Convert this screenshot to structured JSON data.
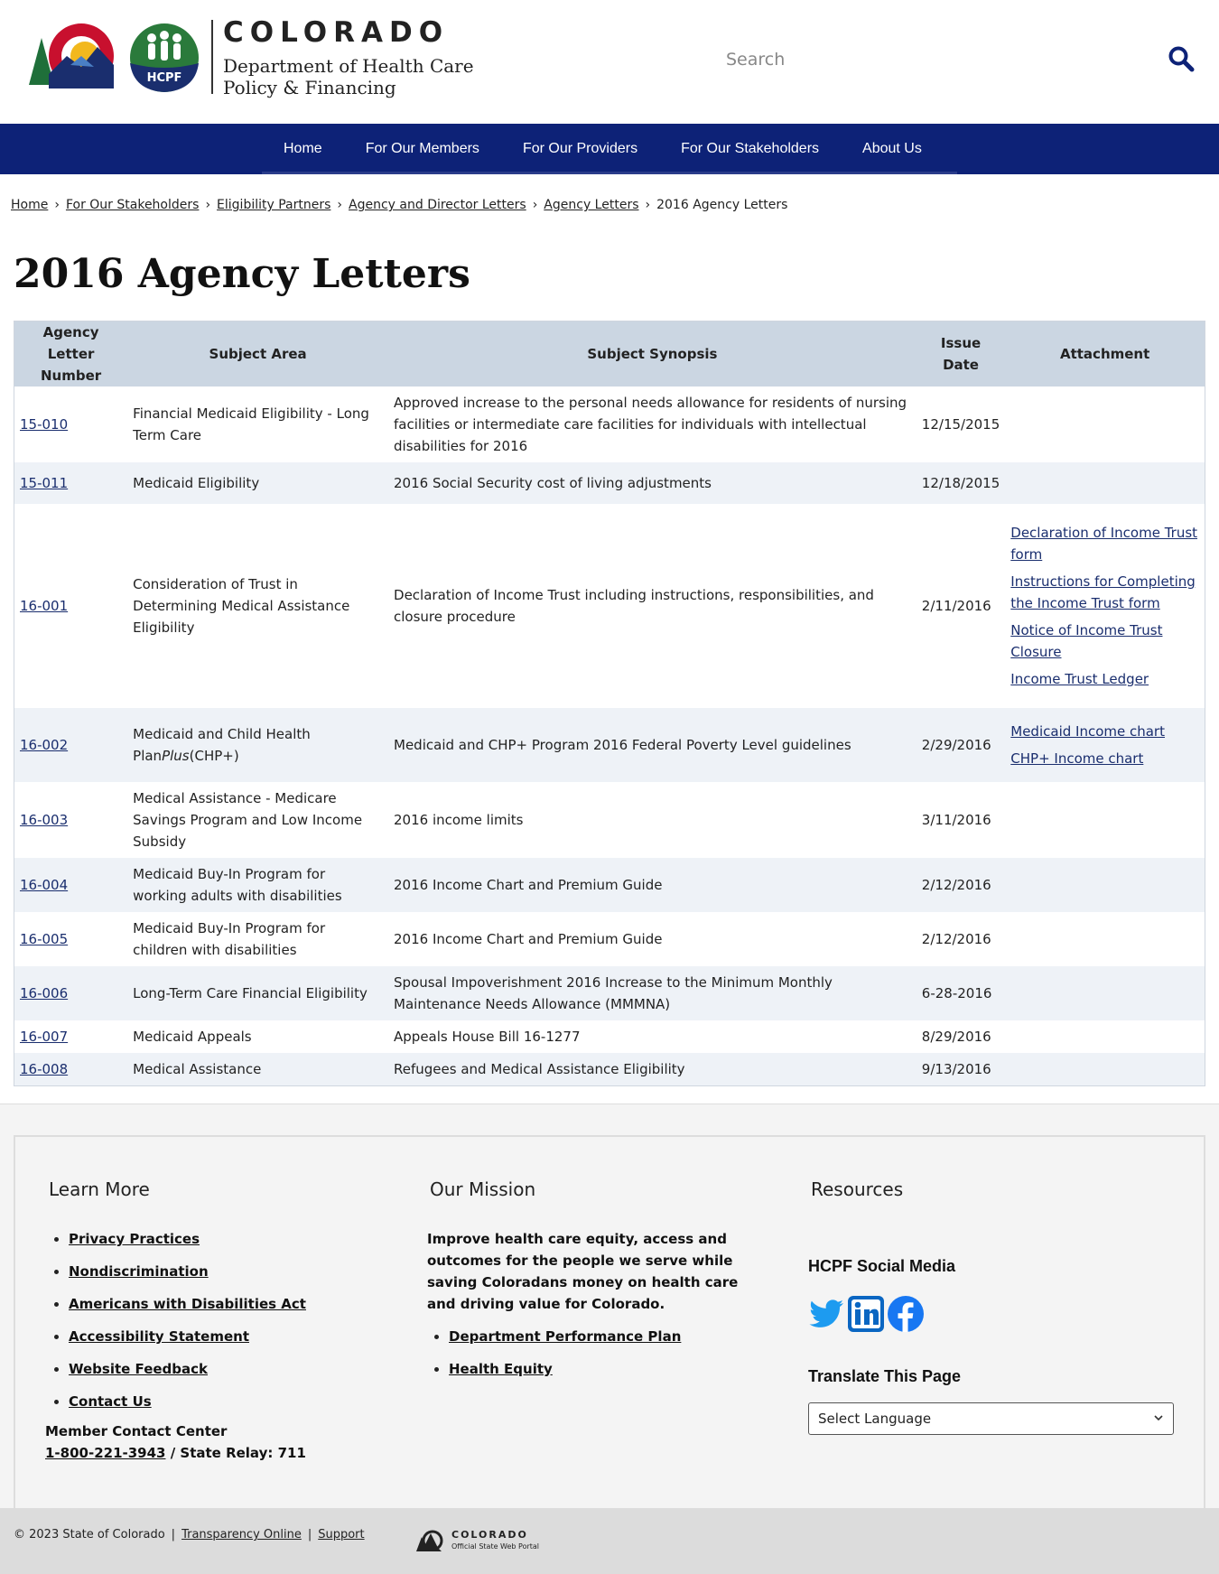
{
  "header": {
    "brand_state": "COLORADO",
    "brand_dept_line1": "Department of Health Care",
    "brand_dept_line2": "Policy & Financing",
    "hcpf_badge": "HCPF",
    "search_placeholder": "Search"
  },
  "nav": {
    "items": [
      "Home",
      "For Our Members",
      "For Our Providers",
      "For Our Stakeholders",
      "About Us"
    ]
  },
  "breadcrumb": {
    "items": [
      "Home",
      "For Our Stakeholders",
      "Eligibility Partners",
      "Agency and Director Letters",
      "Agency Letters"
    ],
    "current": "2016 Agency Letters"
  },
  "page_title": "2016 Agency Letters",
  "table": {
    "headers": [
      "Agency Letter Number",
      "Subject Area",
      "Subject Synopsis",
      "Issue Date",
      "Attachment"
    ],
    "rows": [
      {
        "number": "15-010",
        "subject": "Financial Medicaid Eligibility - Long Term Care",
        "synopsis": "Approved increase to the personal needs allowance for residents of nursing facilities or intermediate care facilities for individuals with intellectual disabilities for 2016",
        "date": "12/15/2015",
        "attachments": []
      },
      {
        "number": "15-011",
        "subject": "Medicaid Eligibility",
        "synopsis": "2016 Social Security cost of living adjustments",
        "date": "12/18/2015",
        "attachments": []
      },
      {
        "number": "16-001",
        "subject": "Consideration of Trust in Determining Medical Assistance Eligibility",
        "synopsis": "Declaration of Income Trust including instructions, responsibilities, and closure procedure",
        "date": "2/11/2016",
        "attachments": [
          "Declaration of Income Trust form",
          "Instructions for Completing the Income Trust form",
          "Notice of Income Trust Closure",
          "Income Trust Ledger"
        ]
      },
      {
        "number": "16-002",
        "subject_prefix": "Medicaid and Child Health Plan",
        "subject_italic": "Plus",
        "subject_suffix": "(CHP+)",
        "synopsis": "Medicaid and CHP+ Program 2016 Federal Poverty Level guidelines",
        "date": "2/29/2016",
        "attachments": [
          "Medicaid Income chart",
          "CHP+ Income chart"
        ]
      },
      {
        "number": "16-003",
        "subject": "Medical Assistance - Medicare Savings Program and Low Income Subsidy",
        "synopsis": "2016 income limits",
        "date": "3/11/2016",
        "attachments": []
      },
      {
        "number": "16-004",
        "subject": "Medicaid Buy-In Program for working adults with disabilities",
        "synopsis": "2016 Income Chart and Premium Guide",
        "date": "2/12/2016",
        "attachments": []
      },
      {
        "number": "16-005",
        "subject": "Medicaid Buy-In Program for children with disabilities",
        "synopsis": "2016 Income Chart and Premium Guide",
        "date": "2/12/2016",
        "attachments": []
      },
      {
        "number": "16-006",
        "subject": "Long-Term Care Financial Eligibility",
        "synopsis": "Spousal Impoverishment 2016 Increase to the Minimum Monthly Maintenance Needs Allowance (MMMNA)",
        "date": "6-28-2016",
        "attachments": []
      },
      {
        "number": "16-007",
        "subject": "Medicaid Appeals",
        "synopsis": "Appeals House Bill 16-1277",
        "date": "8/29/2016",
        "attachments": []
      },
      {
        "number": "16-008",
        "subject": "Medical Assistance",
        "synopsis": "Refugees and Medical Assistance Eligibility",
        "date": "9/13/2016",
        "attachments": []
      }
    ]
  },
  "footer": {
    "learn_more": {
      "heading": "Learn More",
      "links": [
        "Privacy Practices",
        "Nondiscrimination",
        "Americans with Disabilities Act",
        "Accessibility Statement",
        "Website Feedback",
        "Contact Us"
      ],
      "contact_label": "Member Contact Center",
      "phone": "1-800-221-3943",
      "relay": " / State Relay: 711"
    },
    "mission": {
      "heading": "Our Mission",
      "text": "Improve health care equity, access and outcomes for the people we serve while saving Coloradans money on health care and driving value for Colorado.",
      "links": [
        "Department Performance Plan",
        "Health Equity"
      ]
    },
    "resources": {
      "heading": "Resources",
      "social_heading": "HCPF Social Media",
      "social_icons": [
        "twitter-icon",
        "linkedin-icon",
        "facebook-icon"
      ],
      "translate_heading": "Translate This Page",
      "select_value": "Select Language"
    }
  },
  "bottom_bar": {
    "copyright": "© 2023 State of Colorado",
    "links": [
      "Transparency Online",
      "Support"
    ],
    "portal_state": "COLORADO",
    "portal_sub": "Official State Web Portal"
  },
  "colors": {
    "nav_bg": "#0d2277",
    "table_header_bg": "#cbd6e2",
    "row_alt_bg": "#eef2f7",
    "link": "#1a2e6e",
    "social_blue": "#1d9bf0",
    "linkedin": "#0a66c2"
  }
}
